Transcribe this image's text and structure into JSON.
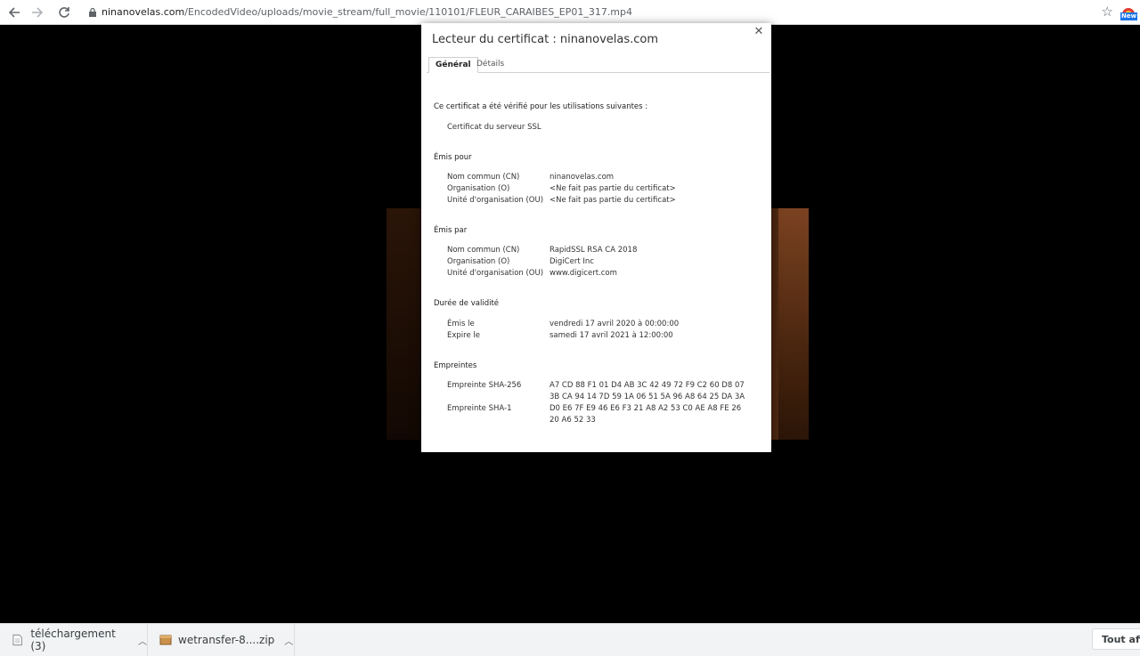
{
  "browser": {
    "url_host": "ninanovelas.com",
    "url_path": "/EncodedVideo/uploads/movie_stream/full_movie/110101/FLEUR_CARAIBES_EP01_317.mp4",
    "extension_badge": "New"
  },
  "dialog": {
    "title": "Lecteur du certificat : ninanovelas.com",
    "tabs": [
      "Général",
      "Détails"
    ],
    "verified_heading": "Ce certificat a été vérifié pour les utilisations suivantes :",
    "usage": "Certificat du serveur SSL",
    "issued_to": {
      "heading": "Émis pour",
      "rows": [
        {
          "label": "Nom commun (CN)",
          "value": "ninanovelas.com"
        },
        {
          "label": "Organisation (O)",
          "value": "<Ne fait pas partie du certificat>"
        },
        {
          "label": "Unité d'organisation (OU)",
          "value": "<Ne fait pas partie du certificat>"
        }
      ]
    },
    "issued_by": {
      "heading": "Émis par",
      "rows": [
        {
          "label": "Nom commun (CN)",
          "value": "RapidSSL RSA CA 2018"
        },
        {
          "label": "Organisation (O)",
          "value": "DigiCert Inc"
        },
        {
          "label": "Unité d'organisation (OU)",
          "value": "www.digicert.com"
        }
      ]
    },
    "validity": {
      "heading": "Durée de validité",
      "rows": [
        {
          "label": "Émis le",
          "value": "vendredi 17 avril 2020 à 00:00:00"
        },
        {
          "label": "Expire le",
          "value": "samedi 17 avril 2021 à 12:00:00"
        }
      ]
    },
    "fingerprints": {
      "heading": "Empreintes",
      "sha256_label": "Empreinte SHA-256",
      "sha256_line1": "A7 CD 88 F1 01 D4 AB 3C 42 49 72 F9 C2 60 D8 07",
      "sha256_line2": "3B CA 94 14 7D 59 1A 06 51 5A 96 A8 64 25 DA 3A",
      "sha1_label": "Empreinte SHA-1",
      "sha1_line1": "D0 E6 7F E9 46 E6 F3 21 A8 A2 53 C0 AE A8 FE 26",
      "sha1_line2": "20 A6 52 33"
    }
  },
  "downloads": [
    {
      "name": "téléchargement (3)"
    },
    {
      "name": "wetransfer-8....zip"
    }
  ],
  "show_all_label": "Tout affi"
}
